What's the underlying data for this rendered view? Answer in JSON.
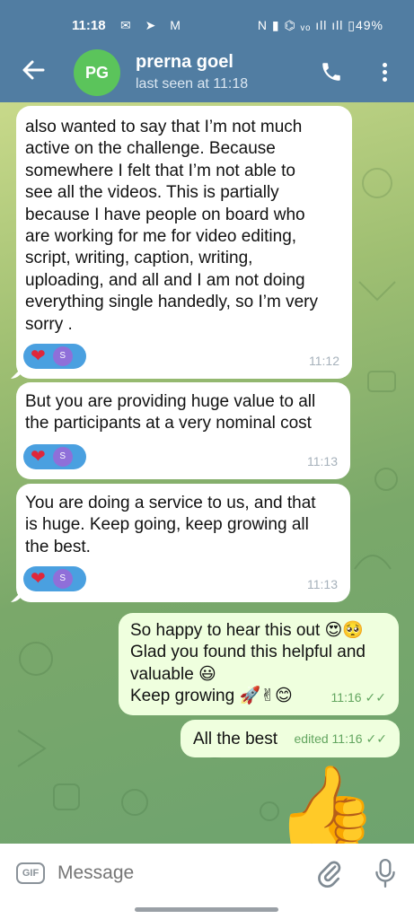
{
  "status_bar": {
    "time": "11:18",
    "left_icons": "✉ ➤ M",
    "right_text": "N ▮ ⌬ ᵥₒ ıll ıll ▯49%"
  },
  "header": {
    "avatar_initials": "PG",
    "avatar_color": "#5bc45b",
    "name": "prerna goel",
    "last_seen": "last seen at 11:18",
    "bar_color": "#517da2"
  },
  "messages": [
    {
      "direction": "in",
      "text": "also wanted to say that I’m not much\nactive on the challenge. Because\nsomewhere I felt that I’m not able to\nsee all the videos. This is partially\nbecause I have people on board who\nare working for me for video editing,\nscript, writing, caption, writing,\nuploading, and all and I am not doing\neverything single handedly, so I’m very\nsorry .",
      "time": "11:12",
      "reaction": "❤",
      "reactor_initial": "S"
    },
    {
      "direction": "in",
      "text": "But you are providing huge value to all\nthe participants at a very nominal cost",
      "time": "11:13",
      "reaction": "❤",
      "reactor_initial": "S"
    },
    {
      "direction": "in",
      "text": "You are doing a service to us, and that\nis huge. Keep going, keep growing all\nthe best.",
      "time": "11:13",
      "reaction": "❤",
      "reactor_initial": "S"
    },
    {
      "direction": "out",
      "text": "So happy to hear this out 😍🥺\nGlad you found this helpful and\nvaluable 😃\nKeep growing 🚀✌😊",
      "time": "11:16",
      "ticks": "✓✓"
    },
    {
      "direction": "out",
      "text": "All the best",
      "time": "edited 11:16",
      "ticks": "✓✓"
    },
    {
      "direction": "out",
      "sticker": "👍"
    }
  ],
  "input": {
    "gif_label": "GIF",
    "placeholder": "Message"
  },
  "icons": {
    "back": "arrow-left-icon",
    "call": "phone-icon",
    "menu": "more-vertical-icon",
    "attach": "paperclip-icon",
    "mic": "microphone-icon"
  }
}
